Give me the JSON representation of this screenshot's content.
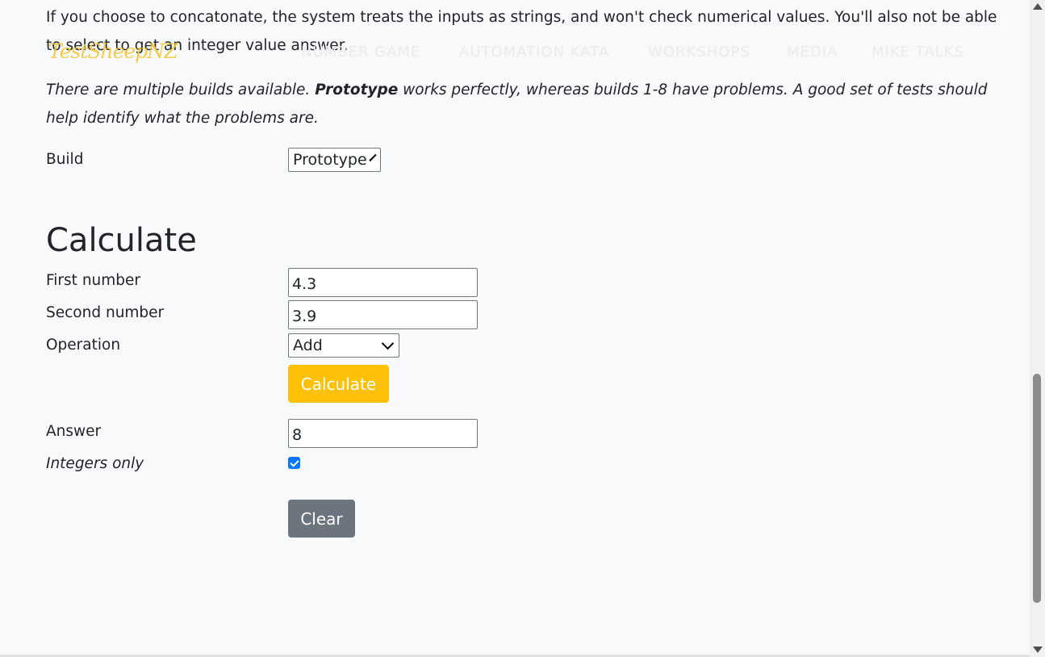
{
  "intro": {
    "paragraph1": "If you choose to concatonate, the system treats the inputs as strings, and won't check numerical values. You'll also not be able to select to get an integer value answer.",
    "paragraph2_pre": "There are multiple builds available. ",
    "paragraph2_bold": "Prototype",
    "paragraph2_post": " works perfectly, whereas builds 1-8 have problems. A good set of tests should help identify what the problems are."
  },
  "navbar": {
    "brand": "TestSheepNZ",
    "items": [
      "NUMBER GAME",
      "AUTOMATION KATA",
      "WORKSHOPS",
      "MEDIA",
      "MIKE TALKS"
    ]
  },
  "build": {
    "label": "Build",
    "selected": "Prototype"
  },
  "calculate": {
    "heading": "Calculate",
    "first_label": "First number",
    "first_value": "4.3",
    "second_label": "Second number",
    "second_value": "3.9",
    "operation_label": "Operation",
    "operation_selected": "Add",
    "calculate_button": "Calculate",
    "answer_label": "Answer",
    "answer_value": "8",
    "integers_label": "Integers only",
    "integers_checked": true,
    "clear_button": "Clear"
  },
  "colors": {
    "primary_btn": "#ffc107",
    "clear_btn": "#6c757d",
    "brand": "#f3c940",
    "checkbox": "#0075ff"
  }
}
